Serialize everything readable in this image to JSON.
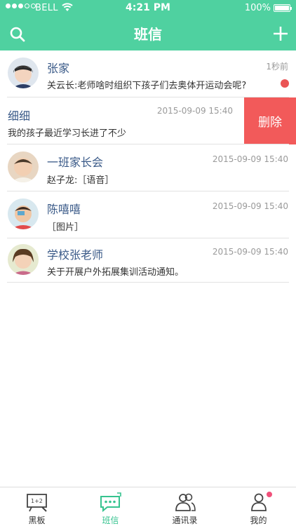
{
  "status_bar": {
    "carrier": "BELL",
    "time": "4:21 PM",
    "battery_pct": "100%"
  },
  "header": {
    "title": "班信"
  },
  "conversations": [
    {
      "name": "张家",
      "time": "1秒前",
      "message": "关云长:老师啥时组织下孩子们去奥体开运动会呢?",
      "unread": true
    },
    {
      "name": "细细",
      "time": "2015-09-09  15:40",
      "message": "我的孩子最近学习长进了不少",
      "action": "删除"
    },
    {
      "name": "一班家长会",
      "time": "2015-09-09  15:40",
      "message": "赵子龙:［语音］"
    },
    {
      "name": "陈嘻嘻",
      "time": "2015-09-09  15:40",
      "message": "［图片］"
    },
    {
      "name": "学校张老师",
      "time": "2015-09-09  15:40",
      "message": "关于开展户外拓展集训活动通知。"
    }
  ],
  "tabs": [
    {
      "label": "黑板",
      "icon": "blackboard-icon"
    },
    {
      "label": "班信",
      "icon": "chat-icon",
      "active": true
    },
    {
      "label": "通讯录",
      "icon": "contacts-icon"
    },
    {
      "label": "我的",
      "icon": "profile-icon",
      "badge": true
    }
  ],
  "colors": {
    "accent": "#4fd1a0",
    "delete": "#f25a5a",
    "unread": "#ea5455",
    "name_text": "#3a5a88",
    "badge": "#f0507a"
  }
}
